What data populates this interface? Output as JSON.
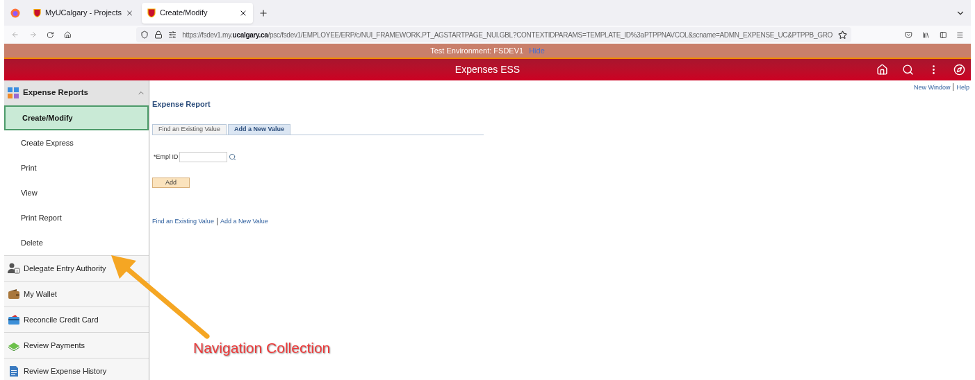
{
  "browser": {
    "tabs": [
      {
        "title": "MyUCalgary - Projects",
        "selected": false
      },
      {
        "title": "Create/Modify",
        "selected": true
      }
    ],
    "url_prefix": "https://fsdev1.my.",
    "url_domain": "ucalgary.ca",
    "url_rest": "/psc/fsdev1/EMPLOYEE/ERP/c/NUI_FRAMEWORK.PT_AGSTARTPAGE_NUI.GBL?CONTEXTIDPARAMS=TEMPLATE_ID%3aPTPPNAVCOL&scname=ADMN_EXPENSE_UC&PTPPB_GRO"
  },
  "environment_banner": {
    "text": "Test Environment: FSDEV1",
    "link": "Hide"
  },
  "header": {
    "title": "Expenses ESS"
  },
  "sidebar": {
    "group": {
      "label": "Expense Reports",
      "expanded": true,
      "items": [
        {
          "label": "Create/Modify",
          "selected": true
        },
        {
          "label": "Create Express",
          "selected": false
        },
        {
          "label": "Print",
          "selected": false
        },
        {
          "label": "View",
          "selected": false
        },
        {
          "label": "Print Report",
          "selected": false
        },
        {
          "label": "Delete",
          "selected": false
        }
      ]
    },
    "items": [
      {
        "label": "Delegate Entry Authority"
      },
      {
        "label": "My Wallet"
      },
      {
        "label": "Reconcile Credit Card"
      },
      {
        "label": "Review Payments"
      },
      {
        "label": "Review Expense History"
      }
    ]
  },
  "top_links": [
    "New Window",
    "Help"
  ],
  "page": {
    "title": "Expense Report",
    "tabs": [
      {
        "label": "Find an Existing Value",
        "selected": false
      },
      {
        "label": "Add a New Value",
        "selected": true
      }
    ],
    "field": {
      "label": "*Empl ID"
    },
    "button": "Add",
    "links": [
      "Find an Existing Value",
      "Add a New Value"
    ]
  },
  "annotation": {
    "text": "Navigation Collection"
  }
}
